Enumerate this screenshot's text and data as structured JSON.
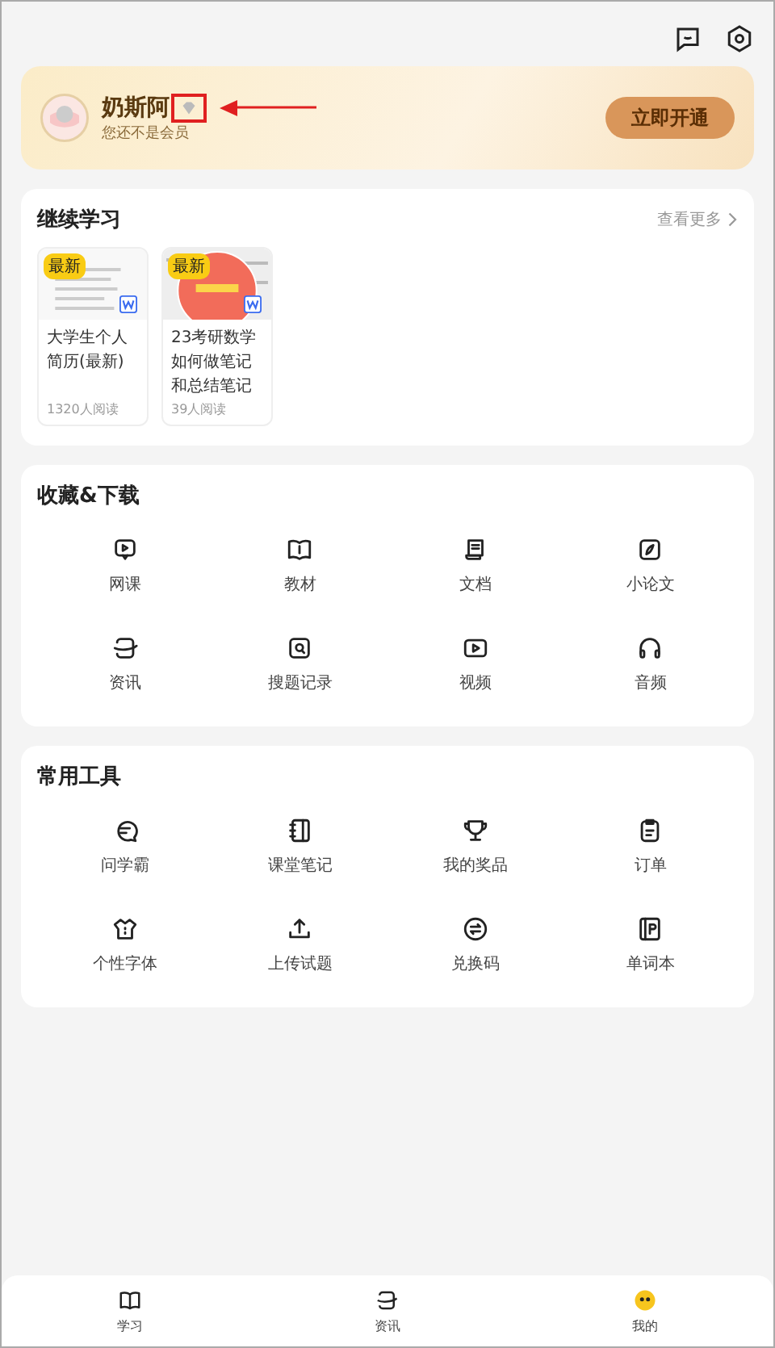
{
  "user": {
    "name": "奶斯阿",
    "subtitle": "您还不是会员",
    "cta": "立即开通"
  },
  "continue": {
    "title": "继续学习",
    "more": "查看更多",
    "cards": [
      {
        "badge": "最新",
        "title": "大学生个人简历(最新)",
        "reads": "1320人阅读"
      },
      {
        "badge": "最新",
        "title": "23考研数学如何做笔记和总结笔记",
        "reads": "39人阅读"
      }
    ]
  },
  "favorites": {
    "title": "收藏&下载",
    "items": [
      "网课",
      "教材",
      "文档",
      "小论文",
      "资讯",
      "搜题记录",
      "视频",
      "音频"
    ]
  },
  "tools": {
    "title": "常用工具",
    "items": [
      "问学霸",
      "课堂笔记",
      "我的奖品",
      "订单",
      "个性字体",
      "上传试题",
      "兑换码",
      "单词本"
    ]
  },
  "tabbar": [
    {
      "label": "学习"
    },
    {
      "label": "资讯"
    },
    {
      "label": "我的"
    }
  ]
}
